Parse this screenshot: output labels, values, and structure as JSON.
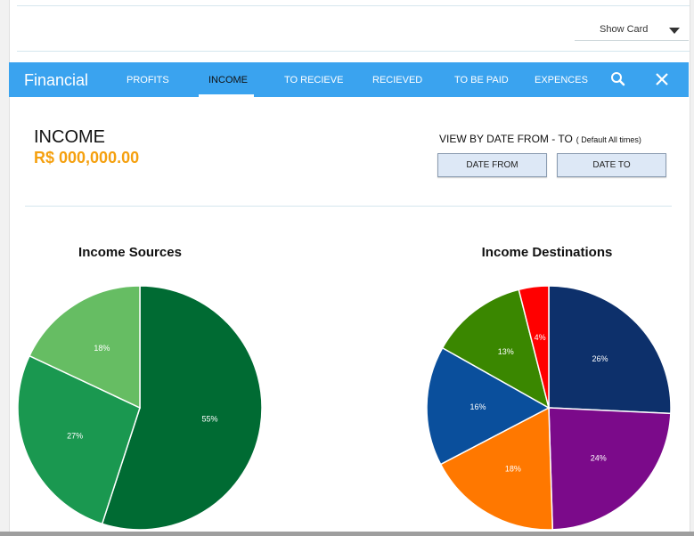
{
  "toolbar": {
    "show_card_label": "Show Card"
  },
  "nav": {
    "brand": "Financial",
    "tabs": [
      "PROFITS",
      "INCOME",
      "TO RECIEVE",
      "RECIEVED",
      "TO BE PAID",
      "EXPENCES"
    ],
    "active_tab": "INCOME",
    "icons": [
      "search-icon",
      "close-icon"
    ],
    "color": "#3aa3ef"
  },
  "summary": {
    "title": "INCOME",
    "amount": "R$ 000,000.00",
    "amount_color": "#f5a00f"
  },
  "filter": {
    "label": "VIEW BY DATE FROM - TO",
    "note": "( Default All times)",
    "date_from": "DATE FROM",
    "date_to": "DATE TO"
  },
  "chart_data": [
    {
      "type": "pie",
      "title": "Income Sources",
      "slices": [
        {
          "label": "55%",
          "value": 55,
          "color": "#006b33"
        },
        {
          "label": "27%",
          "value": 27,
          "color": "#1a9850"
        },
        {
          "label": "18%",
          "value": 18,
          "color": "#66bd63"
        }
      ]
    },
    {
      "type": "pie",
      "title": "Income Destinations",
      "slices": [
        {
          "label": "26%",
          "value": 26,
          "color": "#0d306b"
        },
        {
          "label": "24%",
          "value": 24,
          "color": "#7b0a8a"
        },
        {
          "label": "18%",
          "value": 18,
          "color": "#ff7800"
        },
        {
          "label": "16%",
          "value": 16,
          "color": "#0a4f9c"
        },
        {
          "label": "13%",
          "value": 13,
          "color": "#3a8700"
        },
        {
          "label": "4%",
          "value": 4,
          "color": "#ff0000"
        }
      ]
    }
  ]
}
